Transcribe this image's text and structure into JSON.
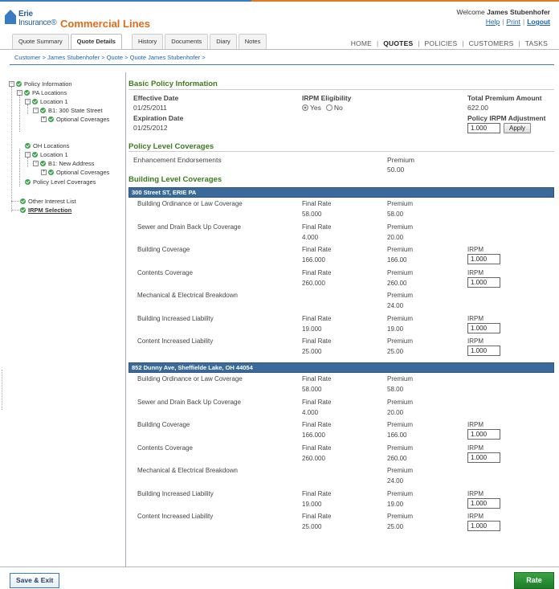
{
  "header": {
    "logo_line1": "Erie",
    "logo_line2": "Insurance®",
    "app_title": "Commercial Lines",
    "welcome_prefix": "Welcome",
    "user_name": "James Stubenhofer",
    "help": "Help",
    "print": "Print",
    "logout": "Logout"
  },
  "tabs": [
    "Quote Summary",
    "Quote Details",
    "History",
    "Documents",
    "Diary",
    "Notes"
  ],
  "active_tab": "Quote Details",
  "main_nav": [
    "HOME",
    "QUOTES",
    "POLICIES",
    "CUSTOMERS",
    "TASKS"
  ],
  "active_nav": "QUOTES",
  "breadcrumb": "Customer > James Stubenhofer > Quote > Quote James Stubenhofer >",
  "tree": {
    "policy_information": "Policy Information",
    "pa_locations": "PA Locations",
    "pa_location1": "Location 1",
    "pa_building": "B1: 300 State Street",
    "pa_optional": "Optional Coverages",
    "oh_locations": "OH Locations",
    "oh_location1": "Location 1",
    "oh_building": "B1: New Address",
    "oh_optional": "Optional Coverages",
    "policy_level": "Policy Level Coverages",
    "other_interest": "Other Interest List",
    "irpm_selection": "IRPM Selection"
  },
  "basic": {
    "title": "Basic Policy Information",
    "effective_label": "Effective Date",
    "effective_value": "01/25/2011",
    "expiration_label": "Expiration Date",
    "expiration_value": "01/25/2012",
    "irpm_eligibility_label": "IRPM Eligibility",
    "yes": "Yes",
    "no": "No",
    "total_premium_label": "Total Premium Amount",
    "total_premium_value": "622.00",
    "policy_irpm_label": "Policy IRPM Adjustment",
    "policy_irpm_value": "1.000",
    "apply": "Apply"
  },
  "policy_level": {
    "title": "Policy Level Coverages",
    "item": "Enhancement Endorsements",
    "premium_label": "Premium",
    "premium_value": "50.00"
  },
  "building_level": {
    "title": "Building Level Coverages",
    "final_rate_label": "Final Rate",
    "premium_label": "Premium",
    "irpm_label": "IRPM",
    "buildings": [
      {
        "address": "300 Street ST, ERIE PA",
        "rows": [
          {
            "name": "Building Ordinance or Law Coverage",
            "final_rate": "58.000",
            "premium": "58.00",
            "irpm": null
          },
          {
            "name": "Sewer and Drain Back Up Coverage",
            "final_rate": "4.000",
            "premium": "20.00",
            "irpm": null
          },
          {
            "name": "Building Coverage",
            "final_rate": "166.000",
            "premium": "166.00",
            "irpm": "1.000"
          },
          {
            "name": "Contents Coverage",
            "final_rate": "260.000",
            "premium": "260.00",
            "irpm": "1.000"
          },
          {
            "name": "Mechanical & Electrical Breakdown",
            "final_rate": null,
            "premium": "24.00",
            "irpm": null
          },
          {
            "name": "Building Increased Liability",
            "final_rate": "19.000",
            "premium": "19.00",
            "irpm": "1.000"
          },
          {
            "name": "Content Increased Liability",
            "final_rate": "25.000",
            "premium": "25.00",
            "irpm": "1.000"
          }
        ]
      },
      {
        "address": "852 Dunny Ave, Sheffielde Lake, OH 44054",
        "rows": [
          {
            "name": "Building Ordinance or Law Coverage",
            "final_rate": "58.000",
            "premium": "58.00",
            "irpm": null
          },
          {
            "name": "Sewer and Drain Back Up Coverage",
            "final_rate": "4.000",
            "premium": "20.00",
            "irpm": null
          },
          {
            "name": "Building Coverage",
            "final_rate": "166.000",
            "premium": "166.00",
            "irpm": "1.000"
          },
          {
            "name": "Contents Coverage",
            "final_rate": "260.000",
            "premium": "260.00",
            "irpm": "1.000"
          },
          {
            "name": "Mechanical & Electrical Breakdown",
            "final_rate": null,
            "premium": "24.00",
            "irpm": null
          },
          {
            "name": "Building Increased Liability",
            "final_rate": "19.000",
            "premium": "19.00",
            "irpm": "1.000"
          },
          {
            "name": "Content Increased Liability",
            "final_rate": "25.000",
            "premium": "25.00",
            "irpm": "1.000"
          }
        ]
      }
    ]
  },
  "footer": {
    "save_exit": "Save & Exit",
    "rate": "Rate"
  },
  "colors": {
    "brand_blue": "#3a7cc0",
    "brand_orange": "#e06b1a",
    "section_green": "#3b7a1e",
    "bar_blue": "#3a6a9a",
    "rate_green": "#2a8f35"
  }
}
